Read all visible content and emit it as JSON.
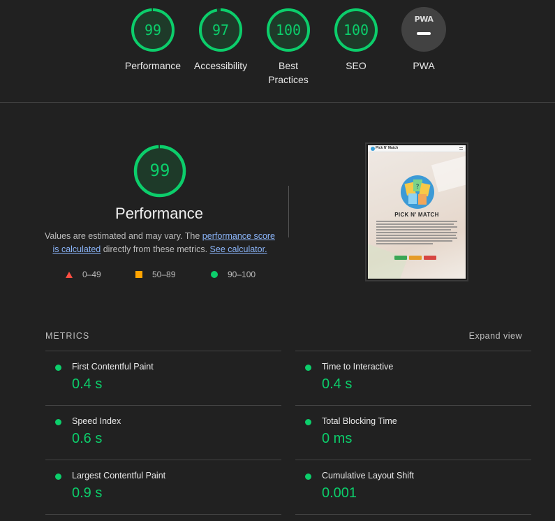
{
  "categories": [
    {
      "label": "Performance",
      "score": "99",
      "fraction": 0.99
    },
    {
      "label": "Accessibility",
      "score": "97",
      "fraction": 0.97
    },
    {
      "label": "Best Practices",
      "score": "100",
      "fraction": 1.0
    },
    {
      "label": "SEO",
      "score": "100",
      "fraction": 1.0
    },
    {
      "label": "PWA",
      "badge": "PWA"
    }
  ],
  "colors": {
    "pass": "#0cce6b",
    "average": "#ffa400",
    "fail": "#ff4e42",
    "link": "#8ab4f8"
  },
  "summary": {
    "score": "99",
    "title": "Performance",
    "desc_part1": "Values are estimated and may vary. The ",
    "link_score": "performance score is calculated",
    "desc_part2": " directly from these metrics. ",
    "link_calc": "See calculator."
  },
  "legend": [
    {
      "shape": "triangle",
      "range": "0–49"
    },
    {
      "shape": "square",
      "range": "50–89"
    },
    {
      "shape": "circle",
      "range": "90–100"
    }
  ],
  "thumbnail": {
    "brand": "Pick N' Match",
    "title": "PICK N' MATCH"
  },
  "metrics": {
    "header": "METRICS",
    "expand": "Expand view",
    "items": [
      {
        "label": "First Contentful Paint",
        "value": "0.4 s"
      },
      {
        "label": "Time to Interactive",
        "value": "0.4 s"
      },
      {
        "label": "Speed Index",
        "value": "0.6 s"
      },
      {
        "label": "Total Blocking Time",
        "value": "0 ms"
      },
      {
        "label": "Largest Contentful Paint",
        "value": "0.9 s"
      },
      {
        "label": "Cumulative Layout Shift",
        "value": "0.001"
      }
    ]
  }
}
